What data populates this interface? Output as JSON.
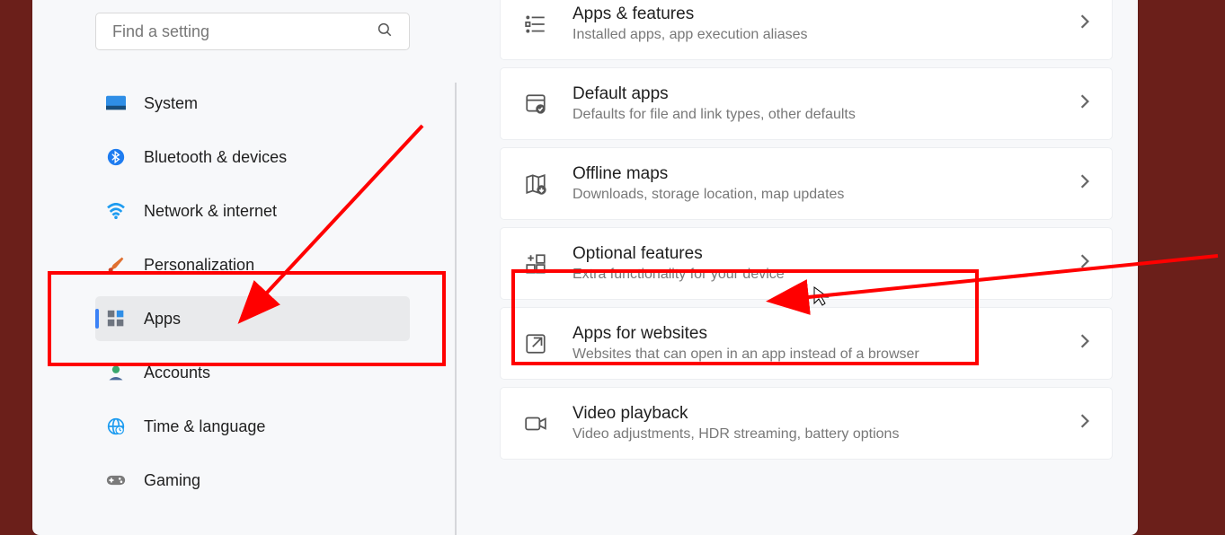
{
  "search": {
    "placeholder": "Find a setting"
  },
  "sidebar": {
    "items": [
      {
        "label": "System"
      },
      {
        "label": "Bluetooth & devices"
      },
      {
        "label": "Network & internet"
      },
      {
        "label": "Personalization"
      },
      {
        "label": "Apps"
      },
      {
        "label": "Accounts"
      },
      {
        "label": "Time & language"
      },
      {
        "label": "Gaming"
      }
    ]
  },
  "cards": [
    {
      "title": "Apps & features",
      "subtitle": "Installed apps, app execution aliases"
    },
    {
      "title": "Default apps",
      "subtitle": "Defaults for file and link types, other defaults"
    },
    {
      "title": "Offline maps",
      "subtitle": "Downloads, storage location, map updates"
    },
    {
      "title": "Optional features",
      "subtitle": "Extra functionality for your device"
    },
    {
      "title": "Apps for websites",
      "subtitle": "Websites that can open in an app instead of a browser"
    },
    {
      "title": "Video playback",
      "subtitle": "Video adjustments, HDR streaming, battery options"
    }
  ]
}
